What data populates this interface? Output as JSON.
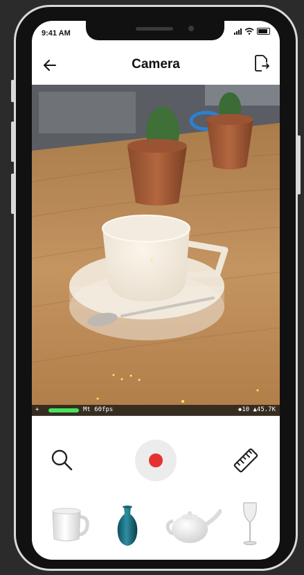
{
  "status_bar": {
    "time": "9:41 AM"
  },
  "header": {
    "title": "Camera",
    "back_icon": "arrow-left-icon",
    "export_icon": "file-export-icon"
  },
  "viewport": {
    "hud": {
      "add_symbol": "+",
      "fps_text": "Mt 60fps",
      "stats_text": "◆10 ▲45.7K",
      "performance_color": "#47e35a"
    }
  },
  "controls": {
    "search_icon": "search-icon",
    "record_icon": "record-icon",
    "record_color": "#e63131",
    "measure_icon": "ruler-icon"
  },
  "models": [
    {
      "name": "mug",
      "icon": "mug-icon"
    },
    {
      "name": "vase",
      "icon": "vase-icon"
    },
    {
      "name": "teapot",
      "icon": "teapot-icon"
    },
    {
      "name": "wine glass",
      "icon": "wine-glass-icon"
    }
  ]
}
